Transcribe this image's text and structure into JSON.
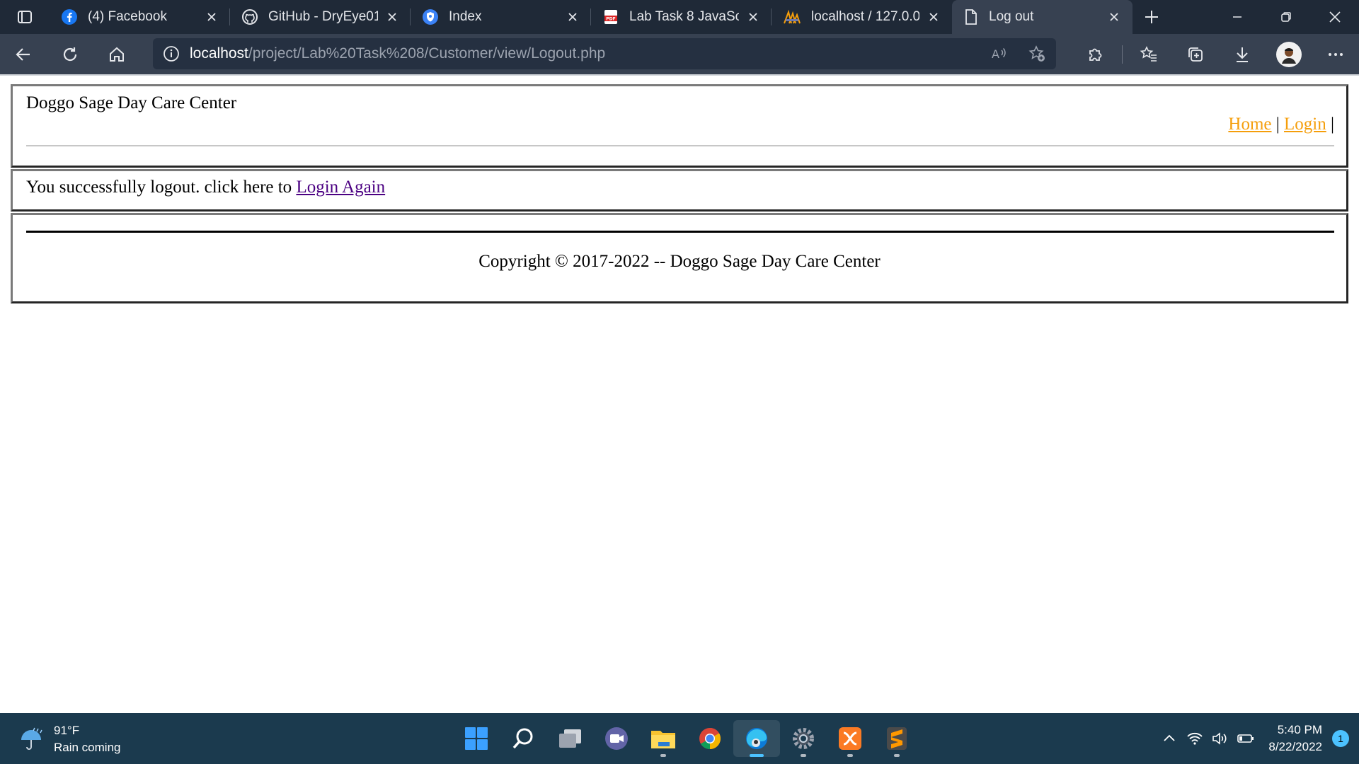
{
  "browser": {
    "tabs": [
      {
        "title": "(4) Facebook",
        "icon": "facebook-icon"
      },
      {
        "title": "GitHub - DryEye01/",
        "icon": "github-icon"
      },
      {
        "title": "Index",
        "icon": "shield-icon"
      },
      {
        "title": "Lab Task 8 JavaScrip",
        "icon": "pdf-icon"
      },
      {
        "title": "localhost / 127.0.0.1",
        "icon": "phpmyadmin-icon"
      },
      {
        "title": "Log out",
        "icon": "page-icon",
        "active": true
      }
    ],
    "address": {
      "host": "localhost",
      "path": "/project/Lab%20Task%208/Customer/view/Logout.php"
    }
  },
  "page": {
    "site_name": "Doggo Sage Day Care Center",
    "nav": {
      "home": "Home",
      "separator": "|",
      "login": "Login",
      "trailing": "|"
    },
    "message": {
      "text": "You successfully logout. click here to ",
      "link": "Login Again"
    },
    "footer": {
      "copyright": "Copyright © 2017-2022 -- Doggo Sage Day Care Center"
    }
  },
  "taskbar": {
    "weather": {
      "temp": "91°F",
      "desc": "Rain coming"
    },
    "apps": [
      "start-icon",
      "search-icon",
      "task-view-icon",
      "teams-icon",
      "file-explorer-icon",
      "chrome-icon",
      "edge-icon",
      "settings-icon",
      "xampp-icon",
      "sublime-icon"
    ],
    "clock": {
      "time": "5:40 PM",
      "date": "8/22/2022"
    },
    "notifications": "1"
  },
  "colors": {
    "link_nav": "#f59e0b",
    "link_visited": "#4b0082",
    "tabbar": "#1f2937",
    "taskbar": "#1b3a4e"
  }
}
